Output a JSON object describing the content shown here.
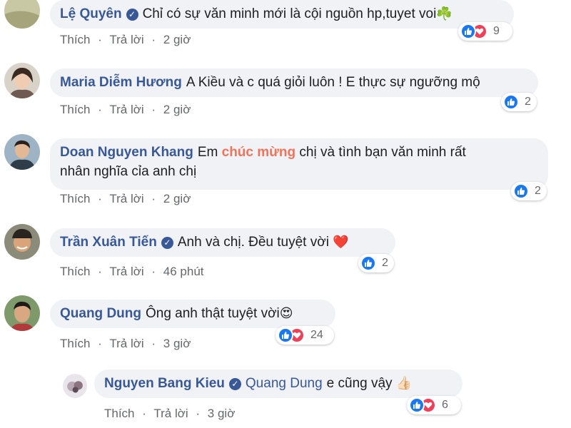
{
  "actions": {
    "like": "Thích",
    "reply": "Trả lời",
    "separator": "·"
  },
  "comments": [
    {
      "author": "Lệ Quyên",
      "text": "Chỉ có sự văn minh mới là cội nguồn hp,tuyet voi",
      "emoji": "☘️",
      "time": "2 giờ",
      "reactions": "9"
    },
    {
      "author": "Maria Diễm Hương",
      "text": "A Kiều và c quá giỏi luôn ! E thực sự ngưỡng mộ",
      "time": "2 giờ",
      "reactions": "2"
    },
    {
      "author": "Doan Nguyen Khang",
      "text_before": "Em",
      "text_highlight": "chúc mừng",
      "text_after": "chị và tình bạn văn minh rất",
      "text_line2": "nhân nghĩa cỉa anh chị",
      "time": "2 giờ",
      "reactions": "2"
    },
    {
      "author": "Trần Xuân Tiến",
      "text": "Anh và chị. Đều tuyệt vời",
      "emoji": "❤️",
      "time": "46 phút",
      "reactions": "2"
    },
    {
      "author": "Quang Dung",
      "text": "Ông anh thật tuyệt vời",
      "emoji": "😍",
      "time": "3 giờ",
      "reactions": "24"
    }
  ],
  "reply": {
    "author": "Nguyen Bang Kieu",
    "mention": "Quang Dung",
    "text": "e cũng vậy",
    "emoji": "👍🏻",
    "time": "3 giờ",
    "reactions": "6"
  },
  "colors": {
    "author": "#385898",
    "like": "#1877f2",
    "love": "#f33e58",
    "highlight": "#f0735a",
    "bubble": "#f0f2f5"
  }
}
